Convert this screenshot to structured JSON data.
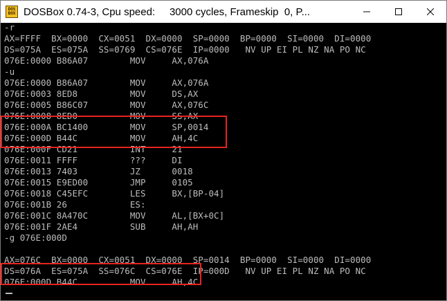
{
  "window": {
    "title": "DOSBox 0.74-3, Cpu speed:     3000 cycles, Frameskip  0, P...",
    "icon_text_top": "DOS",
    "icon_text_bottom": "BOX"
  },
  "colors": {
    "terminal_bg": "#000000",
    "terminal_text": "#bdbdbd",
    "highlight_border": "#e8231f"
  },
  "terminal": {
    "lines": [
      "-r",
      "AX=FFFF  BX=0000  CX=0051  DX=0000  SP=0000  BP=0000  SI=0000  DI=0000",
      "DS=075A  ES=075A  SS=0769  CS=076E  IP=0000   NV UP EI PL NZ NA PO NC",
      "076E:0000 B86A07        MOV     AX,076A",
      "-u",
      "076E:0000 B86A07        MOV     AX,076A",
      "076E:0003 8ED8          MOV     DS,AX",
      "076E:0005 B86C07        MOV     AX,076C",
      "076E:0008 8ED0          MOV     SS,AX",
      "076E:000A BC1400        MOV     SP,0014",
      "076E:000D B44C          MOV     AH,4C",
      "076E:000F CD21          INT     21",
      "076E:0011 FFFF          ???     DI",
      "076E:0013 7403          JZ      0018",
      "076E:0015 E9ED00        JMP     0105",
      "076E:0018 C45EFC        LES     BX,[BP-04]",
      "076E:001B 26            ES:",
      "076E:001C 8A470C        MOV     AL,[BX+0C]",
      "076E:001F 2AE4          SUB     AH,AH",
      "-g 076E:000D",
      "",
      "AX=076C  BX=0000  CX=0051  DX=0000  SP=0014  BP=0000  SI=0000  DI=0000",
      "DS=076A  ES=075A  SS=076C  CS=076E  IP=000D   NV UP EI PL NZ NA PO NC",
      "076E:000D B44C          MOV     AH,4C",
      "-"
    ]
  }
}
